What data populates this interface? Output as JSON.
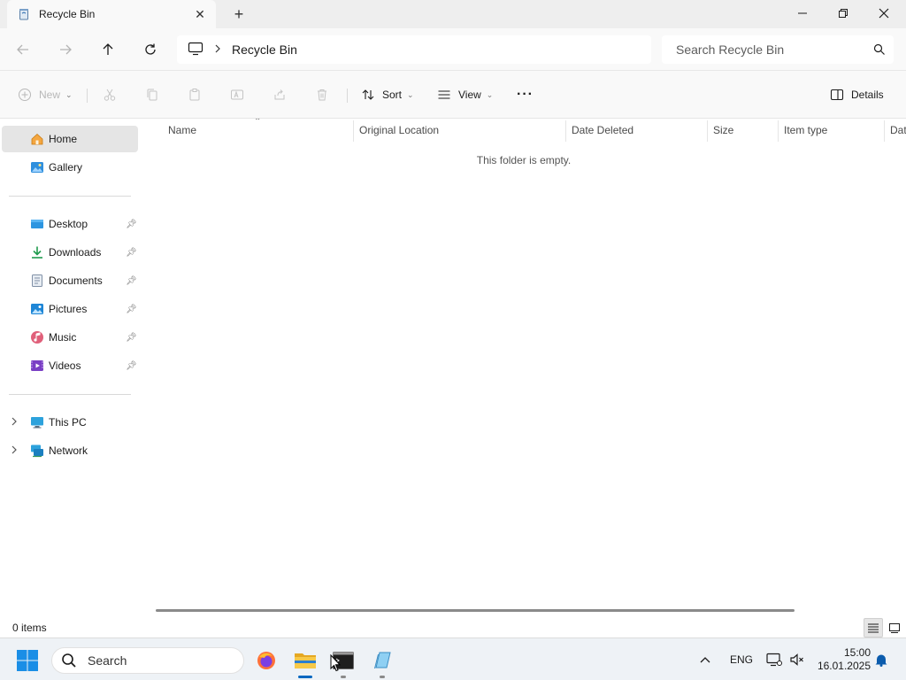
{
  "window": {
    "tab_title": "Recycle Bin",
    "new_tab": "+",
    "close_tab": "✕"
  },
  "nav": {
    "breadcrumb": [
      "Recycle Bin"
    ],
    "search_placeholder": "Search Recycle Bin"
  },
  "commandbar": {
    "new_label": "New",
    "sort_label": "Sort",
    "view_label": "View",
    "more_label": "···",
    "details_label": "Details"
  },
  "sidebar": {
    "quick": [
      {
        "label": "Home",
        "icon": "home-icon",
        "selected": true
      },
      {
        "label": "Gallery",
        "icon": "gallery-icon"
      }
    ],
    "pinned": [
      {
        "label": "Desktop",
        "icon": "desktop-icon"
      },
      {
        "label": "Downloads",
        "icon": "downloads-icon"
      },
      {
        "label": "Documents",
        "icon": "documents-icon"
      },
      {
        "label": "Pictures",
        "icon": "pictures-icon"
      },
      {
        "label": "Music",
        "icon": "music-icon"
      },
      {
        "label": "Videos",
        "icon": "videos-icon"
      }
    ],
    "devices": [
      {
        "label": "This PC",
        "icon": "this-pc-icon"
      },
      {
        "label": "Network",
        "icon": "network-icon"
      }
    ]
  },
  "columns": [
    "Name",
    "Original Location",
    "Date Deleted",
    "Size",
    "Item type",
    "Dat"
  ],
  "content": {
    "empty_message": "This folder is empty."
  },
  "status": {
    "item_count": "0 items"
  },
  "taskbar": {
    "search_label": "Search",
    "language": "ENG",
    "time": "15:00",
    "date": "16.01.2025"
  },
  "colors": {
    "accent": "#0067c0",
    "selected_bg": "#e5e5e5",
    "folder": "#f4c542"
  }
}
